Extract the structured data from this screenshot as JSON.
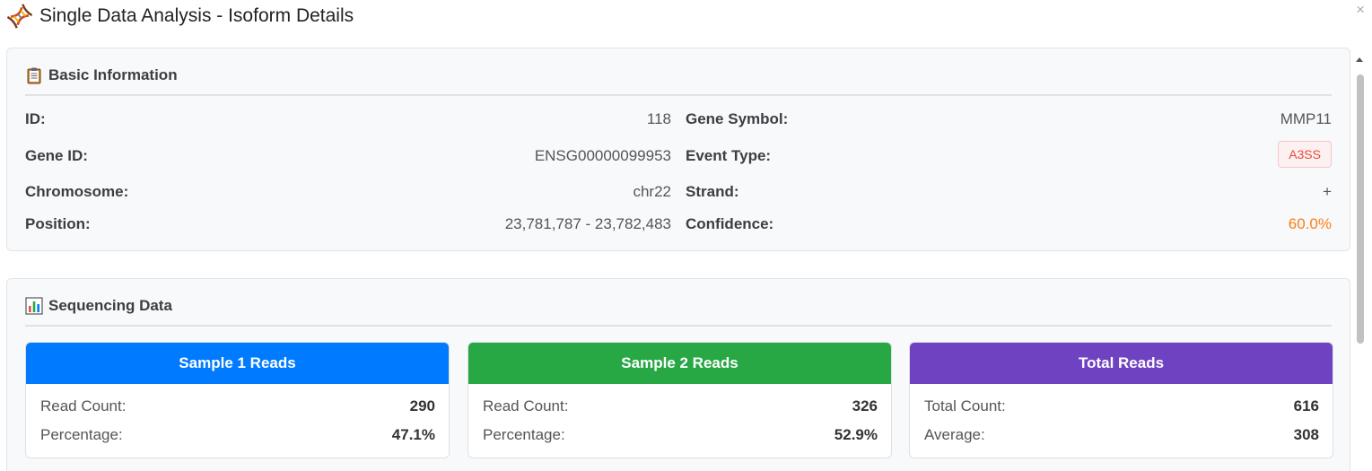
{
  "dialog": {
    "title": "Single Data Analysis - Isoform Details",
    "close_glyph": "×"
  },
  "basic_info": {
    "heading": "Basic Information",
    "rows": [
      {
        "left_label": "ID:",
        "left_value": "118",
        "right_label": "Gene Symbol:",
        "right_value": "MMP11"
      },
      {
        "left_label": "Gene ID:",
        "left_value": "ENSG00000099953",
        "right_label": "Event Type:",
        "right_value": "A3SS"
      },
      {
        "left_label": "Chromosome:",
        "left_value": "chr22",
        "right_label": "Strand:",
        "right_value": "+"
      },
      {
        "left_label": "Position:",
        "left_value": "23,781,787 - 23,782,483",
        "right_label": "Confidence:",
        "right_value": "60.0%"
      }
    ]
  },
  "sequencing": {
    "heading": "Sequencing Data",
    "cards": [
      {
        "title": "Sample 1 Reads",
        "color": "#007bff",
        "row1_label": "Read Count:",
        "row1_value": "290",
        "row2_label": "Percentage:",
        "row2_value": "47.1%"
      },
      {
        "title": "Sample 2 Reads",
        "color": "#28a745",
        "row1_label": "Read Count:",
        "row1_value": "326",
        "row2_label": "Percentage:",
        "row2_value": "52.9%"
      },
      {
        "title": "Total Reads",
        "color": "#6f42c1",
        "row1_label": "Total Count:",
        "row1_value": "616",
        "row2_label": "Average:",
        "row2_value": "308"
      }
    ]
  },
  "colors": {
    "confidence": "#fd7e14",
    "event_badge_text": "#e74c3c",
    "event_badge_bg": "#fdf0f0"
  },
  "icons": {
    "title": "dna-icon",
    "basic_info": "clipboard-icon",
    "sequencing": "bar-chart-icon",
    "close": "close-icon"
  }
}
